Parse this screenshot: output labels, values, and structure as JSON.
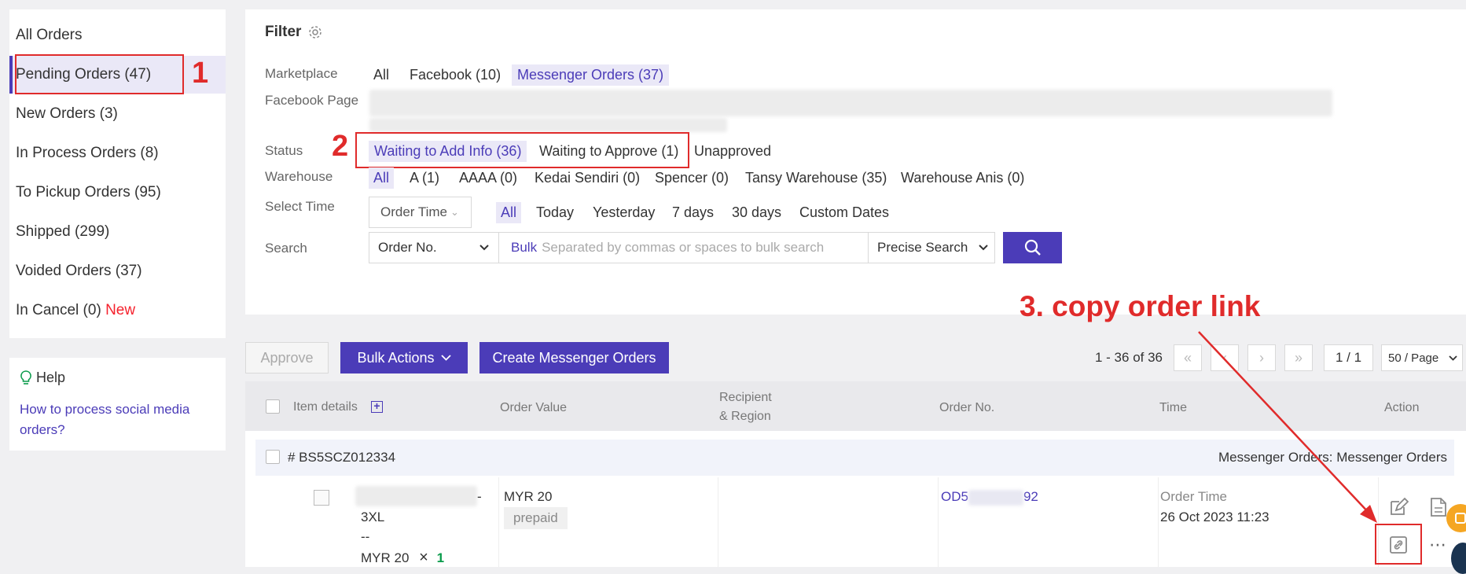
{
  "sidebar": {
    "items": [
      {
        "label": "All Orders"
      },
      {
        "label": "Pending Orders (47)"
      },
      {
        "label": "New Orders (3)"
      },
      {
        "label": "In Process Orders (8)"
      },
      {
        "label": "To Pickup Orders (95)"
      },
      {
        "label": "Shipped (299)"
      },
      {
        "label": "Voided Orders (37)"
      },
      {
        "label": "In Cancel (0)",
        "tag": "New"
      }
    ],
    "help": {
      "title": "Help",
      "link": "How to process social media orders?"
    }
  },
  "filter": {
    "title": "Filter",
    "marketplace": {
      "label": "Marketplace",
      "options": [
        "All",
        "Facebook (10)",
        "Messenger Orders (37)"
      ],
      "selected": "Messenger Orders (37)"
    },
    "facebook_page": {
      "label": "Facebook Page"
    },
    "status": {
      "label": "Status",
      "options": [
        "Waiting to Add Info (36)",
        "Waiting to Approve (1)",
        "Unapproved"
      ],
      "selected": "Waiting to Add Info (36)"
    },
    "warehouse": {
      "label": "Warehouse",
      "options": [
        "All",
        "A (1)",
        "AAAA (0)",
        "Kedai Sendiri (0)",
        "Spencer (0)",
        "Tansy Warehouse (35)",
        "Warehouse Anis (0)"
      ],
      "selected": "All"
    },
    "select_time": {
      "label": "Select Time",
      "dropdown": "Order Time",
      "options": [
        "All",
        "Today",
        "Yesterday",
        "7 days",
        "30 days",
        "Custom Dates"
      ],
      "selected": "All"
    },
    "search": {
      "label": "Search",
      "field": "Order No.",
      "bulk": "Bulk",
      "placeholder": "Separated by commas or spaces to bulk search",
      "mode": "Precise Search"
    }
  },
  "annotations": {
    "n1": "1",
    "n2": "2",
    "n3": "3. copy order link"
  },
  "toolbar": {
    "approve": "Approve",
    "bulk_actions": "Bulk Actions",
    "create": "Create Messenger Orders",
    "range": "1 - 36 of 36",
    "page": "1 / 1",
    "page_size": "50 / Page"
  },
  "table": {
    "headers": {
      "item": "Item details",
      "value": "Order Value",
      "recipient1": "Recipient",
      "recipient2": "& Region",
      "order_no": "Order No.",
      "time": "Time",
      "action": "Action"
    },
    "order": {
      "id": "# BS5SCZ012334",
      "source": "Messenger Orders: Messenger Orders",
      "item_suffix": "-",
      "size": "3XL",
      "dash": "--",
      "price": "MYR 20",
      "times": "×",
      "qty": "1",
      "value": "MYR 20",
      "payment": "prepaid",
      "order_no_prefix": "OD5",
      "order_no_suffix": "92",
      "time_label": "Order Time",
      "time_value": "26 Oct 2023 11:23"
    }
  },
  "colors": {
    "accent": "#4b3cb8",
    "red": "#e02b2b",
    "new": "#f5222d",
    "green": "#0a9b4b"
  }
}
